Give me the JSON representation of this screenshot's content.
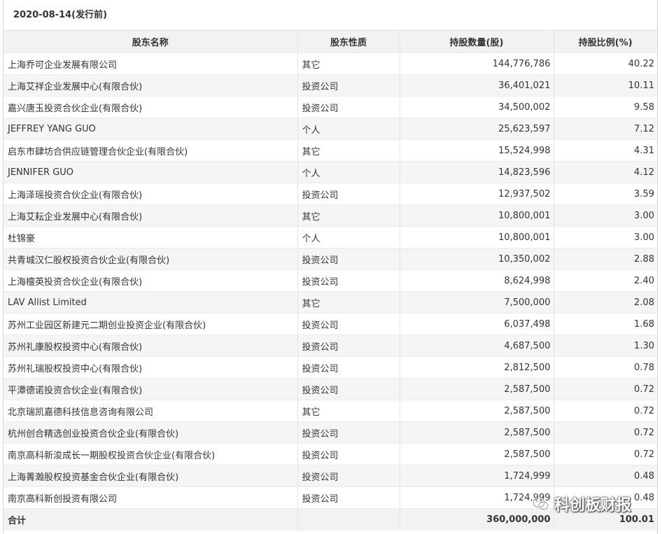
{
  "title": "2020-08-14(发行前)",
  "headers": {
    "name": "股东名称",
    "type": "股东性质",
    "shares": "持股数量(股)",
    "ratio": "持股比例(%)"
  },
  "rows": [
    {
      "name": "上海乔可企业发展有限公司",
      "type": "其它",
      "shares": "144,776,786",
      "ratio": "40.22"
    },
    {
      "name": "上海艾祥企业发展中心(有限合伙)",
      "type": "投资公司",
      "shares": "36,401,021",
      "ratio": "10.11"
    },
    {
      "name": "嘉兴唐玉投资合伙企业(有限合伙)",
      "type": "投资公司",
      "shares": "34,500,002",
      "ratio": "9.58"
    },
    {
      "name": "JEFFREY YANG GUO",
      "type": "个人",
      "shares": "25,623,597",
      "ratio": "7.12"
    },
    {
      "name": "启东市肆坊合供应链管理合伙企业(有限合伙)",
      "type": "其它",
      "shares": "15,524,998",
      "ratio": "4.31"
    },
    {
      "name": "JENNIFER GUO",
      "type": "个人",
      "shares": "14,823,596",
      "ratio": "4.12"
    },
    {
      "name": "上海泽瑶投资合伙企业(有限合伙)",
      "type": "投资公司",
      "shares": "12,937,502",
      "ratio": "3.59"
    },
    {
      "name": "上海艾耘企业发展中心(有限合伙)",
      "type": "其它",
      "shares": "10,800,001",
      "ratio": "3.00"
    },
    {
      "name": "杜锦豪",
      "type": "个人",
      "shares": "10,800,001",
      "ratio": "3.00"
    },
    {
      "name": "共青城汉仁股权投资合伙企业(有限合伙)",
      "type": "投资公司",
      "shares": "10,350,002",
      "ratio": "2.88"
    },
    {
      "name": "上海檀英投资合伙企业(有限合伙)",
      "type": "投资公司",
      "shares": "8,624,998",
      "ratio": "2.40"
    },
    {
      "name": "LAV Allist Limited",
      "type": "其它",
      "shares": "7,500,000",
      "ratio": "2.08"
    },
    {
      "name": "苏州工业园区新建元二期创业投资企业(有限合伙)",
      "type": "投资公司",
      "shares": "6,037,498",
      "ratio": "1.68"
    },
    {
      "name": "苏州礼康股权投资中心(有限合伙)",
      "type": "投资公司",
      "shares": "4,687,500",
      "ratio": "1.30"
    },
    {
      "name": "苏州礼瑞股权投资中心(有限合伙)",
      "type": "投资公司",
      "shares": "2,812,500",
      "ratio": "0.78"
    },
    {
      "name": "平潭德诺投资合伙企业(有限合伙)",
      "type": "投资公司",
      "shares": "2,587,500",
      "ratio": "0.72"
    },
    {
      "name": "北京瑞凯嘉德科技信息咨询有限公司",
      "type": "其它",
      "shares": "2,587,500",
      "ratio": "0.72"
    },
    {
      "name": "杭州创合精选创业投资合伙企业(有限合伙)",
      "type": "投资公司",
      "shares": "2,587,500",
      "ratio": "0.72"
    },
    {
      "name": "南京高科新浚成长一期股权投资合伙企业(有限合伙)",
      "type": "投资公司",
      "shares": "2,587,500",
      "ratio": "0.72"
    },
    {
      "name": "上海菁瀚股权投资基金合伙企业(有限合伙)",
      "type": "投资公司",
      "shares": "1,724,999",
      "ratio": "0.48"
    },
    {
      "name": "南京高科新创投资有限公司",
      "type": "投资公司",
      "shares": "1,724,999",
      "ratio": "0.48"
    }
  ],
  "total": {
    "label": "合计",
    "shares": "360,000,000",
    "ratio": "100.01"
  },
  "watermark": {
    "text": "科创板财报",
    "icon": "wechat-icon"
  }
}
